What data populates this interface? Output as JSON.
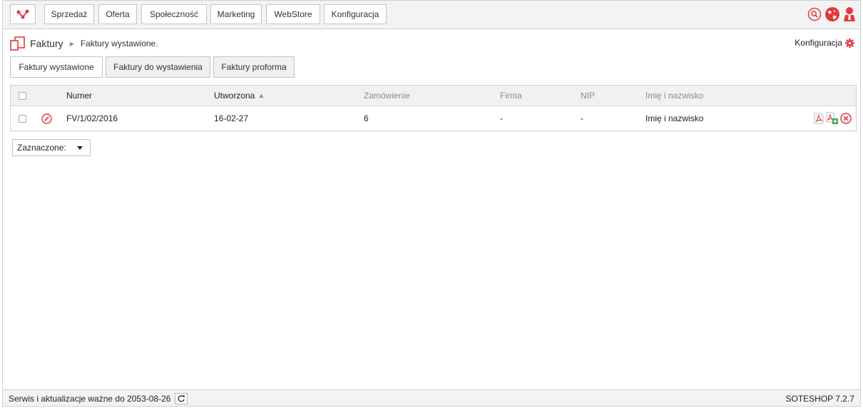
{
  "nav": {
    "items": [
      {
        "label": "Sprzedaż"
      },
      {
        "label": "Oferta"
      },
      {
        "label": "Społeczność"
      },
      {
        "label": "Marketing"
      },
      {
        "label": "WebStore"
      },
      {
        "label": "Konfiguracja"
      }
    ],
    "icons": [
      "search-icon",
      "globe-icon",
      "user-icon"
    ]
  },
  "breadcrumb": {
    "title": "Faktury",
    "current": "Faktury wystawione."
  },
  "config_link": "Konfiguracja",
  "tabs": [
    {
      "label": "Faktury wystawione",
      "active": true
    },
    {
      "label": "Faktury do wystawienia",
      "active": false
    },
    {
      "label": "Faktury proforma",
      "active": false
    }
  ],
  "table": {
    "columns": [
      "Numer",
      "Utworzona",
      "Zamówienie",
      "Firma",
      "NIP",
      "Imię i nazwisko"
    ],
    "sorted_column": "Utworzona",
    "rows": [
      {
        "numer": "FV/1/02/2016",
        "utworzona": "16-02-27",
        "zamowienie": "6",
        "firma": "-",
        "nip": "-",
        "imie": "Imię i nazwisko"
      }
    ]
  },
  "bulk": {
    "label": "Zaznaczone:"
  },
  "footer": {
    "service": "Serwis i aktualizacje ważne do 2053-08-26",
    "version": "SOTESHOP 7.2.7"
  },
  "colors": {
    "accent": "#e03a3e",
    "grid_header": "#f1f1f1"
  }
}
